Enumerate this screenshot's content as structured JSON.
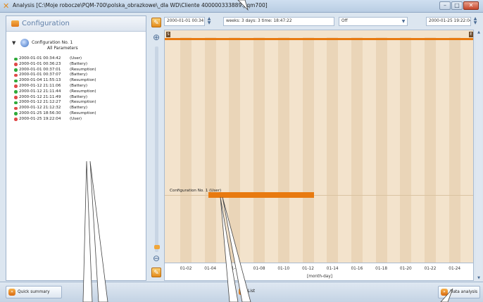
{
  "window": {
    "title": "Analysis [C:\\Moje robocze\\PQM-700\\polska_obrazkowe\\_dla WD\\Cliente 400000333889.pqm700]",
    "controls": {
      "minimize": "–",
      "maximize": "□",
      "close": "✕"
    }
  },
  "left_panel": {
    "title": "Configuration",
    "tree_root": "Configuration No. 1",
    "all_parameters": "All Parameters",
    "events": [
      {
        "status": "on",
        "timestamp": "2000-01-01 00:34:42",
        "type": "(User)"
      },
      {
        "status": "off",
        "timestamp": "2000-01-01 00:36:23",
        "type": "(Battery)"
      },
      {
        "status": "on",
        "timestamp": "2000-01-01 00:37:01",
        "type": "(Resumption)"
      },
      {
        "status": "off",
        "timestamp": "2000-01-01 00:37:07",
        "type": "(Battery)"
      },
      {
        "status": "on",
        "timestamp": "2000-01-04 11:55:13",
        "type": "(Resumption)"
      },
      {
        "status": "off",
        "timestamp": "2000-01-12 21:11:06",
        "type": "(Battery)"
      },
      {
        "status": "on",
        "timestamp": "2000-01-12 21:11:44",
        "type": "(Resumption)"
      },
      {
        "status": "off",
        "timestamp": "2000-01-12 21:11:49",
        "type": "(Battery)"
      },
      {
        "status": "on",
        "timestamp": "2000-01-12 21:12:27",
        "type": "(Resumption)"
      },
      {
        "status": "off",
        "timestamp": "2000-01-12 21:12:32",
        "type": "(Battery)"
      },
      {
        "status": "on",
        "timestamp": "2000-01-25 18:56:30",
        "type": "(Resumption)"
      },
      {
        "status": "off",
        "timestamp": "2000-01-25 19:22:04",
        "type": "(User)"
      }
    ]
  },
  "toolbar": {
    "start_time": "2000-01-01 00:34:42",
    "duration": "weeks: 3 days: 3 time: 18:47:22",
    "filter": "Off",
    "end_time": "2000-01-25 19:22:04"
  },
  "chart": {
    "marker_start": "S",
    "marker_end": "E",
    "series_label": "Configuration No. 1 (User)",
    "x_ticks": [
      "01-02",
      "01-04",
      "01-06",
      "01-08",
      "01-10",
      "01-12",
      "01-14",
      "01-16",
      "01-18",
      "01-20",
      "01-22",
      "01-24"
    ],
    "x_label": "[month-day]",
    "colors": {
      "bar": "#e87a10",
      "background": "#f3e3cc",
      "stripe": "#ead5b8"
    }
  },
  "bottom": {
    "quick_summary": "Quick summary",
    "list": "List",
    "data_analysis": "Data analysis"
  }
}
